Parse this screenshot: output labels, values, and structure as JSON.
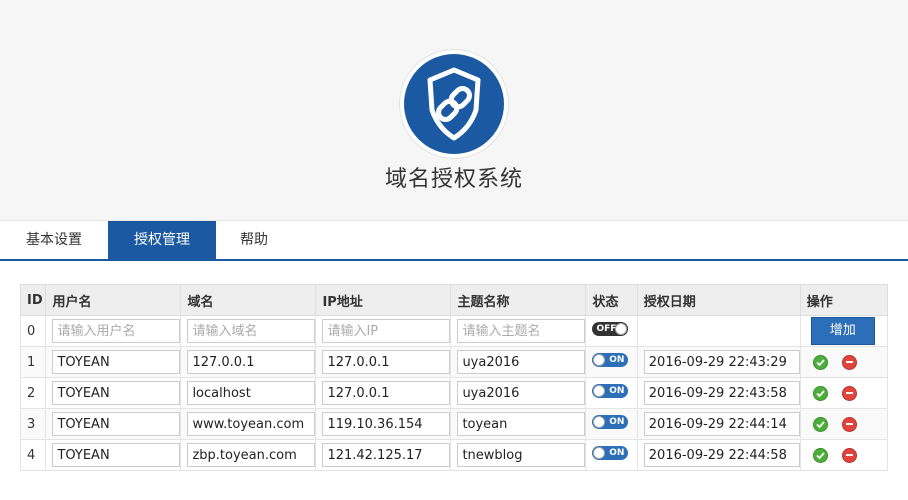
{
  "header": {
    "title": "域名授权系统"
  },
  "tabs": [
    {
      "label": "基本设置",
      "active": false
    },
    {
      "label": "授权管理",
      "active": true
    },
    {
      "label": "帮助",
      "active": false
    }
  ],
  "table": {
    "headers": [
      "ID",
      "用户名",
      "域名",
      "IP地址",
      "主题名称",
      "状态",
      "授权日期",
      "操作"
    ],
    "new_row": {
      "id": "0",
      "placeholders": {
        "user": "请输入用户名",
        "domain": "请输入域名",
        "ip": "请输入IP",
        "theme": "请输入主题名"
      },
      "status": "OFF",
      "add_label": "增加"
    },
    "rows": [
      {
        "id": "1",
        "user": "TOYEAN",
        "domain": "127.0.0.1",
        "ip": "127.0.0.1",
        "theme": "uya2016",
        "status": "ON",
        "date": "2016-09-29 22:43:29"
      },
      {
        "id": "2",
        "user": "TOYEAN",
        "domain": "localhost",
        "ip": "127.0.0.1",
        "theme": "uya2016",
        "status": "ON",
        "date": "2016-09-29 22:43:58"
      },
      {
        "id": "3",
        "user": "TOYEAN",
        "domain": "www.toyean.com",
        "ip": "119.10.36.154",
        "theme": "toyean",
        "status": "ON",
        "date": "2016-09-29 22:44:14"
      },
      {
        "id": "4",
        "user": "TOYEAN",
        "domain": "zbp.toyean.com",
        "ip": "121.42.125.17",
        "theme": "tnewblog",
        "status": "ON",
        "date": "2016-09-29 22:44:58"
      }
    ]
  },
  "colors": {
    "brand": "#1b5aa2",
    "button": "#2d6eb8",
    "ok": "#4caf3c",
    "delete": "#e0443c"
  },
  "icons": {
    "logo": "shield-link-icon",
    "save": "check-circle-icon",
    "delete": "minus-circle-icon"
  }
}
